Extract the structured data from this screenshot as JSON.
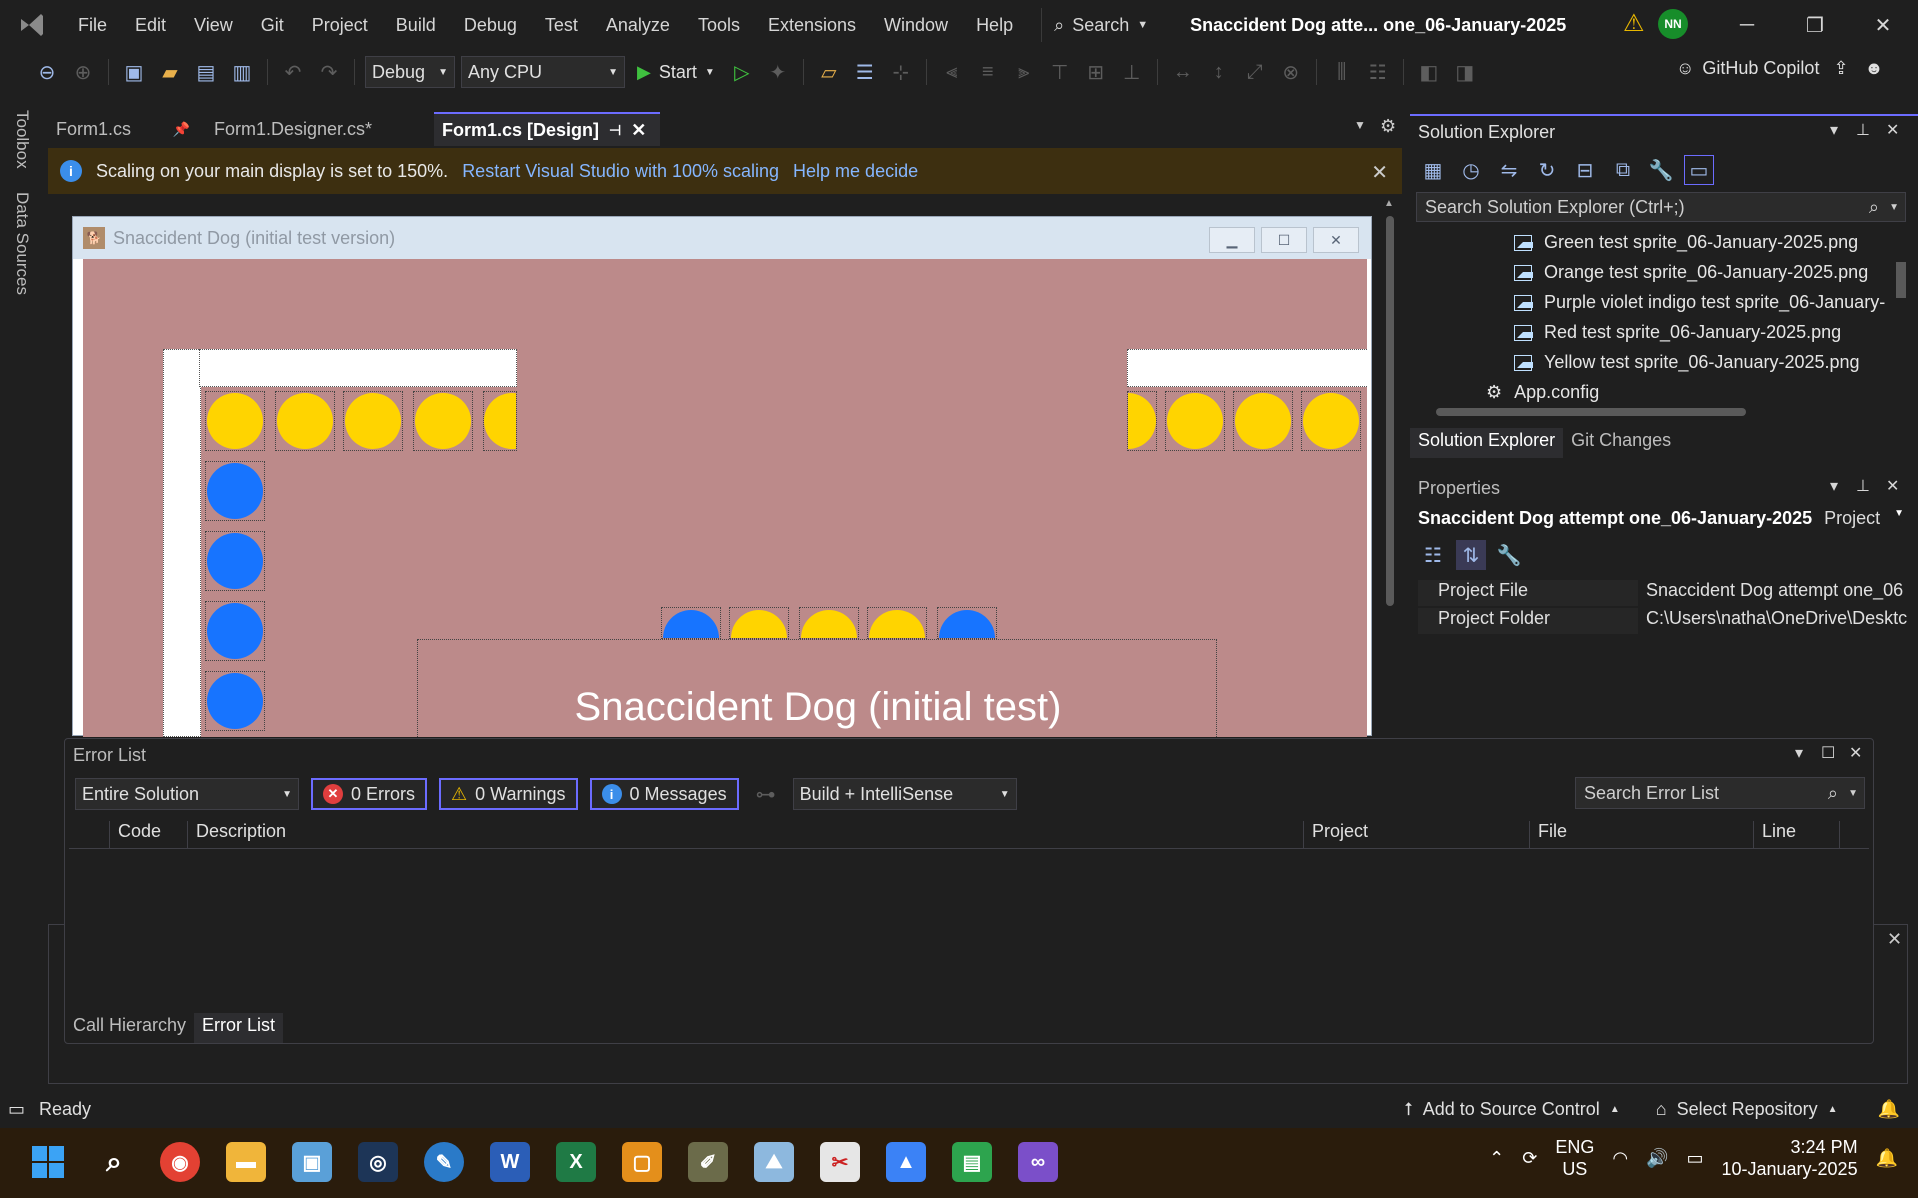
{
  "menubar": {
    "items": [
      "File",
      "Edit",
      "View",
      "Git",
      "Project",
      "Build",
      "Debug",
      "Test",
      "Analyze",
      "Tools",
      "Extensions",
      "Window",
      "Help"
    ],
    "search_label": "Search",
    "window_title": "Snaccident Dog atte... one_06-January-2025",
    "avatar_initials": "NN"
  },
  "toolbar": {
    "config": "Debug",
    "platform": "Any CPU",
    "start_label": "Start",
    "copilot_label": "GitHub Copilot"
  },
  "left_rail": {
    "toolbox": "Toolbox",
    "data_sources": "Data Sources"
  },
  "doc_tabs": [
    {
      "label": "Form1.cs",
      "active": false
    },
    {
      "label": "Form1.Designer.cs*",
      "active": false
    },
    {
      "label": "Form1.cs [Design]",
      "active": true
    }
  ],
  "infobar": {
    "message": "Scaling on your main display is set to 150%.",
    "link1": "Restart Visual Studio with 100% scaling",
    "link2": "Help me decide"
  },
  "designer": {
    "form_title": "Snaccident Dog (initial test version)",
    "label_text": "Snaccident Dog (initial test)"
  },
  "solution_explorer": {
    "title": "Solution Explorer",
    "search_placeholder": "Search Solution Explorer (Ctrl+;)",
    "items": [
      "Green test sprite_06-January-2025.png",
      "Orange test sprite_06-January-2025.png",
      "Purple violet indigo test sprite_06-January-",
      "Red test sprite_06-January-2025.png",
      "Yellow test sprite_06-January-2025.png",
      "App.config"
    ],
    "bottom_tabs": [
      "Solution Explorer",
      "Git Changes"
    ]
  },
  "properties": {
    "title": "Properties",
    "object_name": "Snaccident Dog attempt one_06-January-2025",
    "object_type": "Project",
    "rows": [
      {
        "key": "Project File",
        "value": "Snaccident Dog attempt one_06"
      },
      {
        "key": "Project Folder",
        "value": "C:\\Users\\natha\\OneDrive\\Desktc"
      }
    ]
  },
  "error_list": {
    "title": "Error List",
    "scope": "Entire Solution",
    "errors": "0 Errors",
    "warnings": "0 Warnings",
    "messages": "0 Messages",
    "build_filter": "Build + IntelliSense",
    "search_placeholder": "Search Error List",
    "columns": [
      "Code",
      "Description",
      "Project",
      "File",
      "Line"
    ],
    "bottom_tabs": [
      "Call Hierarchy",
      "Error List"
    ]
  },
  "statusbar": {
    "ready": "Ready",
    "source_control": "Add to Source Control",
    "repository": "Select Repository"
  },
  "taskbar": {
    "lang_top": "ENG",
    "lang_bottom": "US",
    "time": "3:24 PM",
    "date": "10-January-2025"
  },
  "colors": {
    "accent": "#6c6cff",
    "form_bg": "#bc8a8a",
    "yellow": "#ffd400",
    "blue": "#1774ff",
    "infobar": "#3d2f10"
  }
}
